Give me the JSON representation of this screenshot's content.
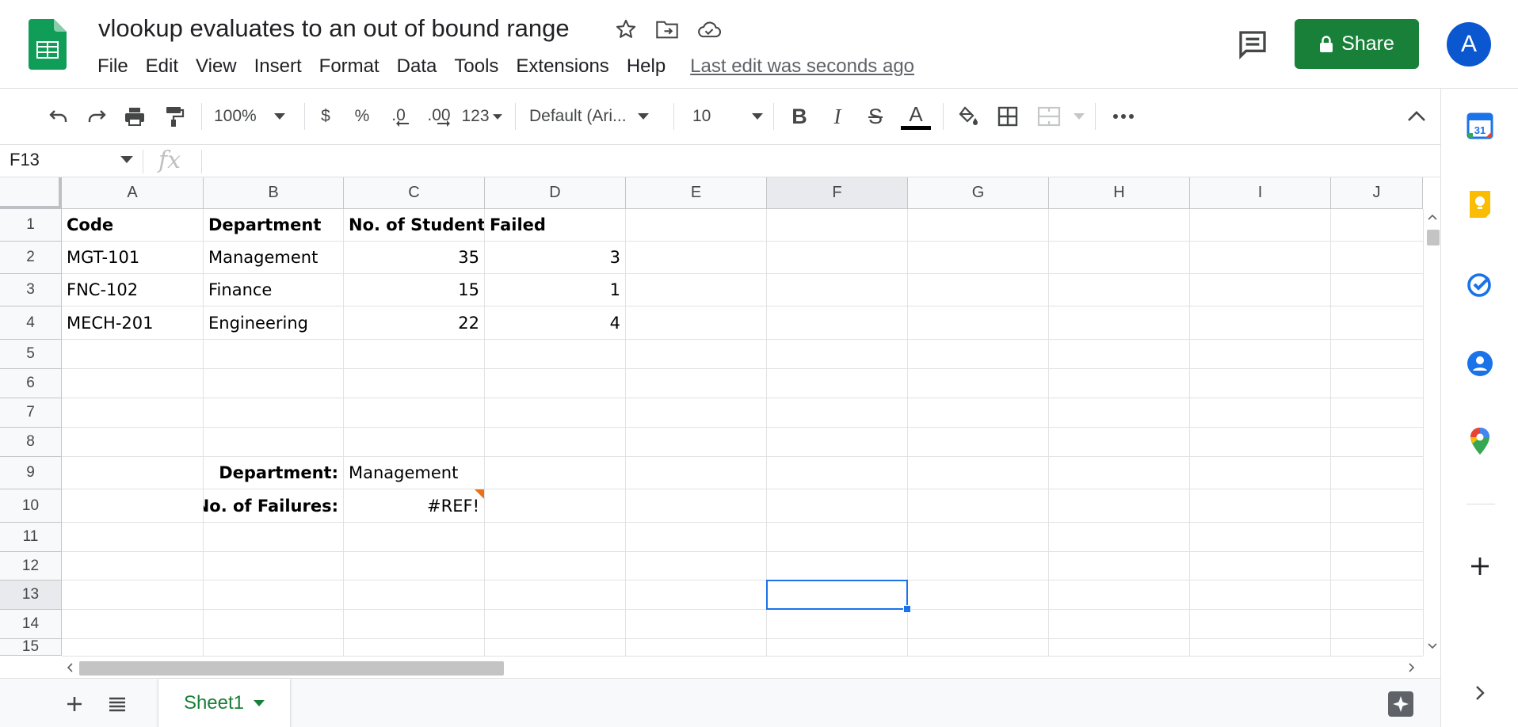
{
  "header": {
    "title": "vlookup evaluates to an out of bound range",
    "menu": [
      "File",
      "Edit",
      "View",
      "Insert",
      "Format",
      "Data",
      "Tools",
      "Extensions",
      "Help"
    ],
    "last_edit": "Last edit was seconds ago",
    "share_label": "Share",
    "avatar_letter": "A"
  },
  "toolbar": {
    "zoom": "100%",
    "currency": "$",
    "percent": "%",
    "decrease_decimal": ".0",
    "increase_decimal": ".00",
    "more_formats": "123",
    "font": "Default (Ari...",
    "font_size": "10",
    "bold": "B",
    "italic": "I",
    "strikethrough": "S",
    "text_color": "A"
  },
  "formula_bar": {
    "name_box": "F13",
    "fx_label": "fx",
    "formula": ""
  },
  "grid": {
    "columns": [
      "A",
      "B",
      "C",
      "D",
      "E",
      "F",
      "G",
      "H",
      "I",
      "J"
    ],
    "rows": [
      "1",
      "2",
      "3",
      "4",
      "5",
      "6",
      "7",
      "8",
      "9",
      "10",
      "11",
      "12",
      "13",
      "14",
      "15"
    ],
    "cells": {
      "A1": "Code",
      "B1": "Department",
      "C1": "No. of Students",
      "D1": "Failed",
      "A2": "MGT-101",
      "B2": "Management",
      "C2": "35",
      "D2": "3",
      "A3": "FNC-102",
      "B3": "Finance",
      "C3": "15",
      "D3": "1",
      "A4": "MECH-201",
      "B4": "Engineering",
      "C4": "22",
      "D4": "4",
      "B9": "Department:",
      "C9": "Management",
      "B10": "No. of Failures:",
      "C10": "#REF!"
    },
    "selected_cell": "F13",
    "colors": {
      "selection": "#1a73e8",
      "error_marker": "#e8711c"
    }
  },
  "sheets": {
    "active": "Sheet1"
  },
  "colors": {
    "share": "#188038",
    "avatar": "#0b57d0"
  }
}
